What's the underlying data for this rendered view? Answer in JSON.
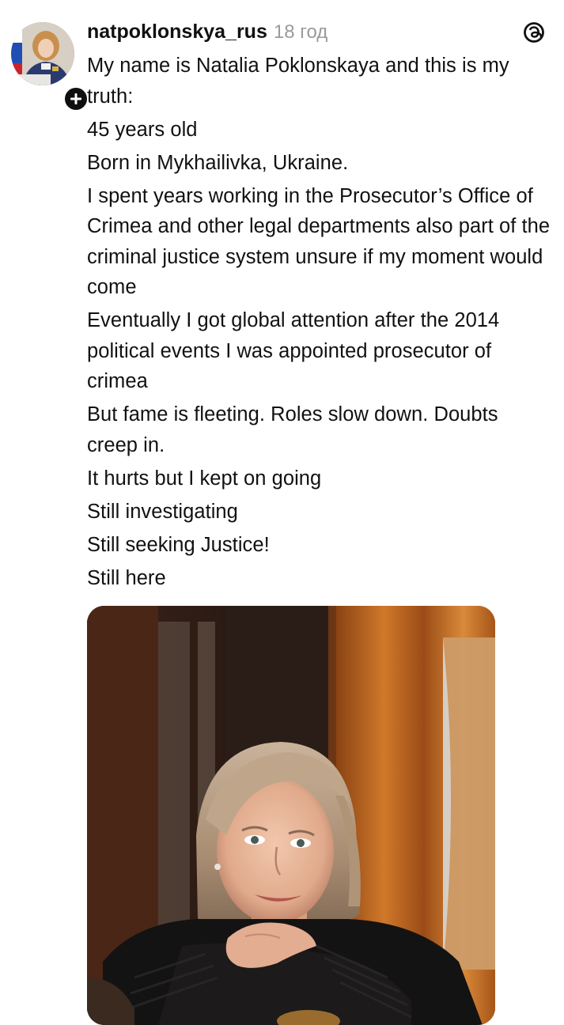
{
  "post": {
    "username": "natpoklonskya_rus",
    "timestamp": "18 год",
    "paragraphs": [
      "My name is Natalia Poklonskaya and this is my truth:",
      "45 years old",
      "Born in Mykhailivka, Ukraine.",
      "I spent years working in the Prosecutor’s Office of Crimea and other legal departments also part of the criminal justice system unsure if my moment would come",
      "Eventually I got global attention after the 2014 political events I was appointed prosecutor of crimea",
      "But fame is fleeting. Roles slow down. Doubts creep in.",
      "It hurts but I kept on going",
      "Still investigating",
      "Still seeking Justice!",
      "Still here"
    ]
  },
  "icons": {
    "follow": "plus-icon",
    "app_logo": "threads-logo-icon"
  },
  "colors": {
    "text": "#111111",
    "muted": "#9a9a9a",
    "badge": "#0f0f0f"
  }
}
